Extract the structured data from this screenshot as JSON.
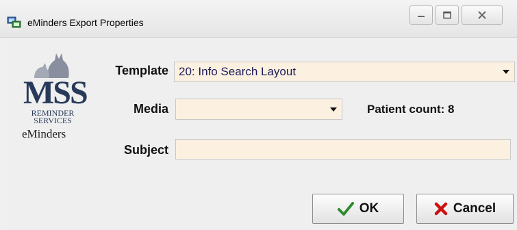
{
  "window": {
    "title": "eMinders Export Properties"
  },
  "logo": {
    "line1": "MSS",
    "line2": "REMINDER",
    "line3": "SERVICES",
    "line4": "eMinders"
  },
  "form": {
    "template_label": "Template",
    "template_value": "20: Info Search Layout",
    "media_label": "Media",
    "media_value": "",
    "subject_label": "Subject",
    "subject_value": "",
    "patient_count_text": "Patient count: 8"
  },
  "buttons": {
    "ok_label": "OK",
    "cancel_label": "Cancel"
  },
  "colors": {
    "field_bg": "#fcf0e0",
    "ok_check": "#2e8b2e",
    "cancel_x": "#cc1111",
    "logo_blue": "#283a5a"
  }
}
